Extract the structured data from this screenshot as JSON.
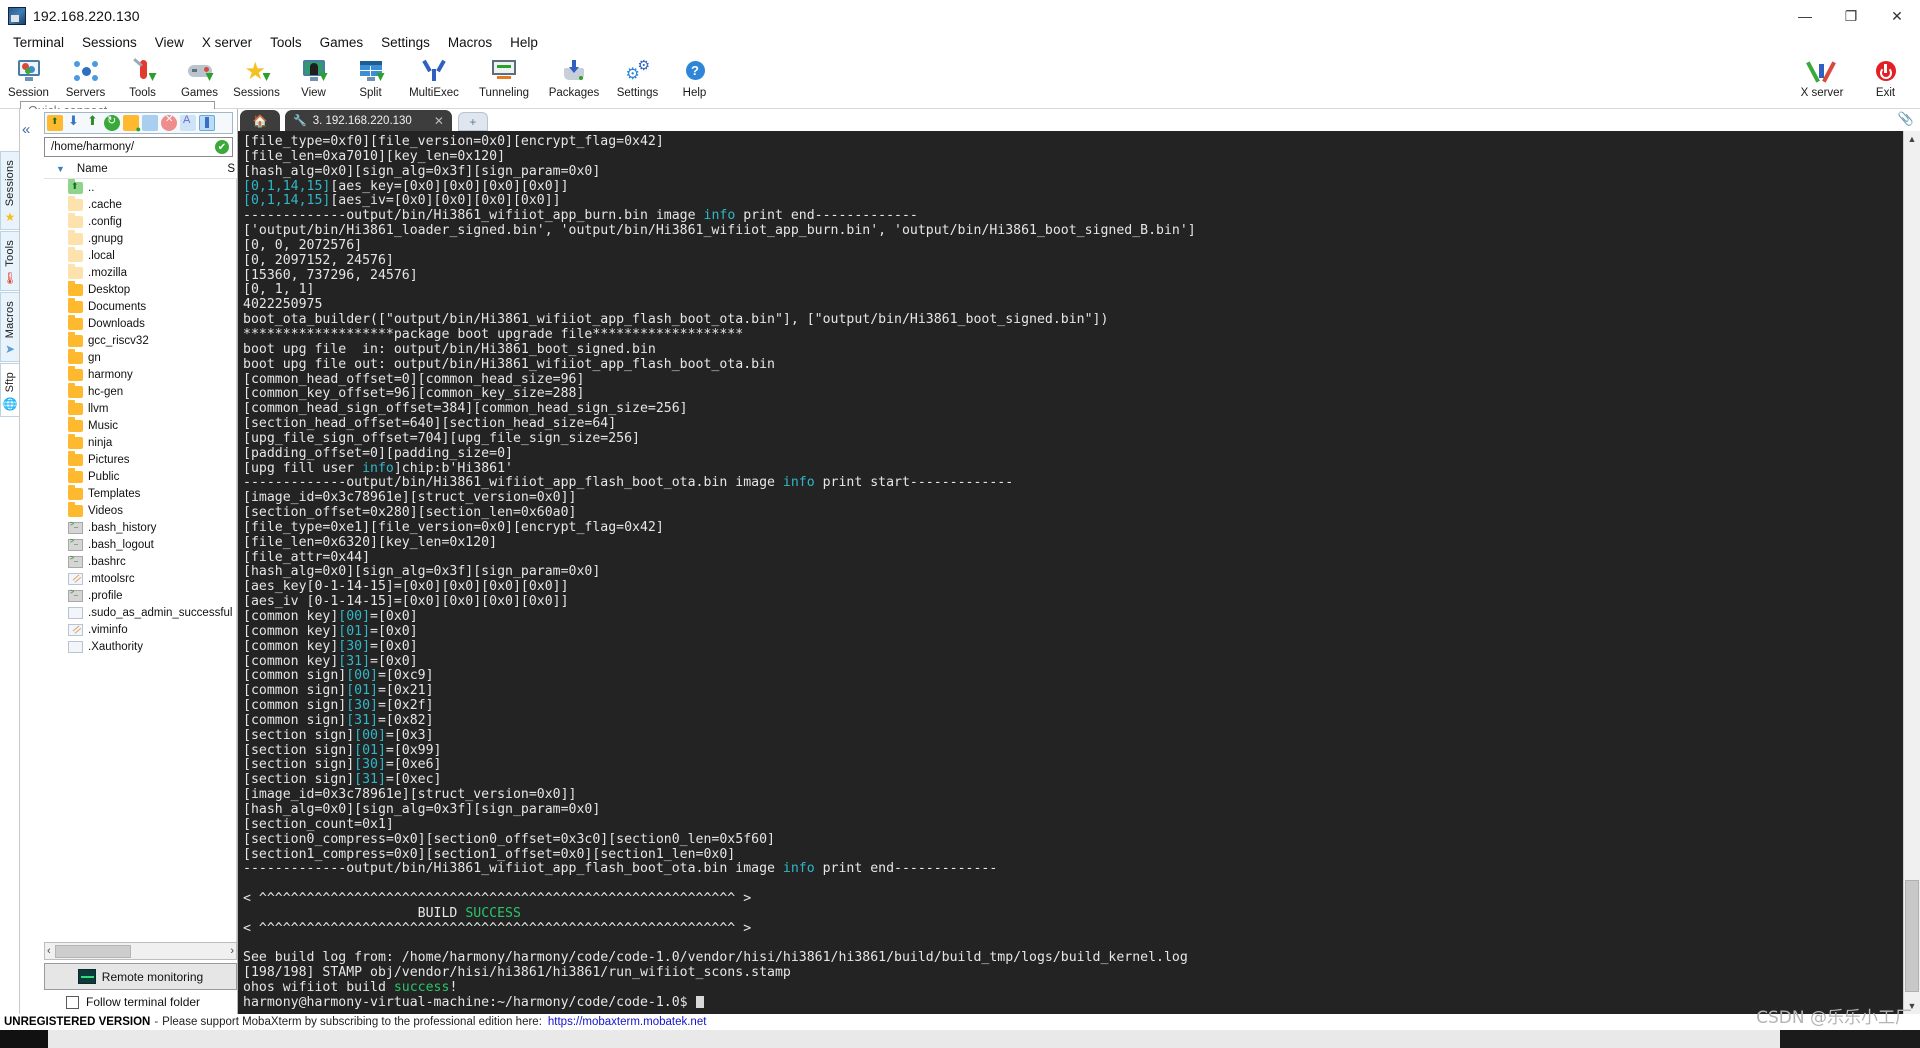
{
  "window": {
    "title": "192.168.220.130",
    "minimize": "—",
    "maximize": "❐",
    "close": "✕"
  },
  "menubar": [
    {
      "label": "Terminal"
    },
    {
      "label": "Sessions"
    },
    {
      "label": "View"
    },
    {
      "label": "X server"
    },
    {
      "label": "Tools"
    },
    {
      "label": "Games"
    },
    {
      "label": "Settings"
    },
    {
      "label": "Macros"
    },
    {
      "label": "Help"
    }
  ],
  "toolbar": {
    "items": [
      {
        "label": "Session",
        "icon": "session-icon"
      },
      {
        "label": "Servers",
        "icon": "servers-icon"
      },
      {
        "label": "Tools",
        "icon": "tools-icon"
      },
      {
        "label": "Games",
        "icon": "games-icon"
      },
      {
        "label": "Sessions",
        "icon": "sessions-star-icon"
      },
      {
        "label": "View",
        "icon": "view-icon"
      },
      {
        "label": "Split",
        "icon": "split-icon"
      },
      {
        "label": "MultiExec",
        "icon": "multiexec-icon"
      },
      {
        "label": "Tunneling",
        "icon": "tunneling-icon"
      },
      {
        "label": "Packages",
        "icon": "packages-icon"
      },
      {
        "label": "Settings",
        "icon": "settings-gear-icon"
      },
      {
        "label": "Help",
        "icon": "help-icon"
      }
    ],
    "right": [
      {
        "label": "X server",
        "icon": "x-server-icon"
      },
      {
        "label": "Exit",
        "icon": "power-exit-icon"
      }
    ]
  },
  "quick_connect": {
    "placeholder": "Quick connect...",
    "value": ""
  },
  "sidebar": {
    "vertical_tabs": [
      {
        "label": "Sessions",
        "icon": "star-icon"
      },
      {
        "label": "Tools",
        "icon": "thermometer-icon"
      },
      {
        "label": "Macros",
        "icon": "paper-plane-icon"
      },
      {
        "label": "Sftp",
        "icon": "globe-icon"
      }
    ],
    "sftp_toolbar_icons": [
      "parent-folder-icon",
      "download-icon",
      "upload-icon",
      "refresh-icon",
      "new-folder-icon",
      "new-file-icon",
      "delete-icon",
      "text-mode-icon",
      "bookmark-icon"
    ],
    "path": {
      "value": "/home/harmony/",
      "status": "✔"
    },
    "column_header": {
      "name": "Name",
      "size": "S"
    },
    "files": [
      {
        "name": "..",
        "type": "up"
      },
      {
        "name": ".cache",
        "type": "folder-pale"
      },
      {
        "name": ".config",
        "type": "folder-pale"
      },
      {
        "name": ".gnupg",
        "type": "folder-pale"
      },
      {
        "name": ".local",
        "type": "folder-pale"
      },
      {
        "name": ".mozilla",
        "type": "folder-pale"
      },
      {
        "name": "Desktop",
        "type": "folder"
      },
      {
        "name": "Documents",
        "type": "folder"
      },
      {
        "name": "Downloads",
        "type": "folder"
      },
      {
        "name": "gcc_riscv32",
        "type": "folder"
      },
      {
        "name": "gn",
        "type": "folder"
      },
      {
        "name": "harmony",
        "type": "folder"
      },
      {
        "name": "hc-gen",
        "type": "folder"
      },
      {
        "name": "llvm",
        "type": "folder"
      },
      {
        "name": "Music",
        "type": "folder"
      },
      {
        "name": "ninja",
        "type": "folder"
      },
      {
        "name": "Pictures",
        "type": "folder"
      },
      {
        "name": "Public",
        "type": "folder"
      },
      {
        "name": "Templates",
        "type": "folder"
      },
      {
        "name": "Videos",
        "type": "folder"
      },
      {
        "name": ".bash_history",
        "type": "shell"
      },
      {
        "name": ".bash_logout",
        "type": "shell"
      },
      {
        "name": ".bashrc",
        "type": "shell"
      },
      {
        "name": ".mtoolsrc",
        "type": "text"
      },
      {
        "name": ".profile",
        "type": "shell"
      },
      {
        "name": ".sudo_as_admin_successful",
        "type": "plain"
      },
      {
        "name": ".viminfo",
        "type": "text"
      },
      {
        "name": ".Xauthority",
        "type": "plain"
      }
    ],
    "remote_monitoring": "Remote monitoring",
    "follow_terminal_folder": "Follow terminal folder",
    "follow_checked": false
  },
  "tabs": {
    "home_icon": "home-icon",
    "session": {
      "label": "3. 192.168.220.130",
      "icon": "wrench-icon",
      "close": "✕"
    },
    "new_tab": "+"
  },
  "terminal": {
    "prompt": "harmony@harmony-virtual-machine:~/harmony/code/code-1.0$",
    "lines": [
      {
        "t": "[file_type=0xf0][file_version=0x0][encrypt_flag=0x42]"
      },
      {
        "t": "[file_len=0xa7010][key_len=0x120]"
      },
      {
        "t": "[hash_alg=0x0][sign_alg=0x3f][sign_param=0x0]"
      },
      {
        "t": "[aes_key",
        "p": [
          [
            "[0,1,14,15]",
            "cy"
          ],
          [
            "=[0x0][0x0][0x0][0x0]]",
            ""
          ]
        ]
      },
      {
        "t": "[aes_iv",
        "p": [
          [
            "[0,1,14,15]",
            "cy"
          ],
          [
            "=[0x0][0x0][0x0][0x0]]",
            ""
          ]
        ]
      },
      {
        "p": [
          [
            "-------------output/bin/Hi3861_wifiiot_app_burn.bin image ",
            ""
          ],
          [
            "info",
            "cy"
          ],
          [
            " print end-------------",
            ""
          ]
        ]
      },
      {
        "t": "['output/bin/Hi3861_loader_signed.bin', 'output/bin/Hi3861_wifiiot_app_burn.bin', 'output/bin/Hi3861_boot_signed_B.bin']"
      },
      {
        "t": "[0, 0, 2072576]"
      },
      {
        "t": "[0, 2097152, 24576]"
      },
      {
        "t": "[15360, 737296, 24576]"
      },
      {
        "t": "[0, 1, 1]"
      },
      {
        "t": "4022250975"
      },
      {
        "t": "boot_ota_builder([\"output/bin/Hi3861_wifiiot_app_flash_boot_ota.bin\"], [\"output/bin/Hi3861_boot_signed.bin\"])"
      },
      {
        "t": "*******************package boot upgrade file*******************"
      },
      {
        "t": "boot upg file  in: output/bin/Hi3861_boot_signed.bin"
      },
      {
        "t": "boot upg file out: output/bin/Hi3861_wifiiot_app_flash_boot_ota.bin"
      },
      {
        "t": "[common_head_offset=0][common_head_size=96]"
      },
      {
        "t": "[common_key_offset=96][common_key_size=288]"
      },
      {
        "t": "[common_head_sign_offset=384][common_head_sign_size=256]"
      },
      {
        "t": "[section_head_offset=640][section_head_size=64]"
      },
      {
        "t": "[upg_file_sign_offset=704][upg_file_sign_size=256]"
      },
      {
        "t": "[padding_offset=0][padding_size=0]"
      },
      {
        "p": [
          [
            "[upg fill user ",
            ""
          ],
          [
            "info",
            "cy"
          ],
          [
            "]chip:b'Hi3861'",
            ""
          ]
        ]
      },
      {
        "p": [
          [
            "-------------output/bin/Hi3861_wifiiot_app_flash_boot_ota.bin image ",
            ""
          ],
          [
            "info",
            "cy"
          ],
          [
            " print start-------------",
            ""
          ]
        ]
      },
      {
        "t": "[image_id=0x3c78961e][struct_version=0x0]]"
      },
      {
        "t": "[section_offset=0x280][section_len=0x60a0]"
      },
      {
        "t": "[file_type=0xe1][file_version=0x0][encrypt_flag=0x42]"
      },
      {
        "t": "[file_len=0x6320][key_len=0x120]"
      },
      {
        "t": "[file_attr=0x44]"
      },
      {
        "t": "[hash_alg=0x0][sign_alg=0x3f][sign_param=0x0]"
      },
      {
        "t": "[aes_key[0-1-14-15]=[0x0][0x0][0x0][0x0]]"
      },
      {
        "t": "[aes_iv [0-1-14-15]=[0x0][0x0][0x0][0x0]]"
      },
      {
        "p": [
          [
            "[common key]",
            ""
          ],
          [
            "[00]",
            "cy"
          ],
          [
            "=[0x0]",
            ""
          ]
        ]
      },
      {
        "p": [
          [
            "[common key]",
            ""
          ],
          [
            "[01]",
            "cy"
          ],
          [
            "=[0x0]",
            ""
          ]
        ]
      },
      {
        "p": [
          [
            "[common key]",
            ""
          ],
          [
            "[30]",
            "cy"
          ],
          [
            "=[0x0]",
            ""
          ]
        ]
      },
      {
        "p": [
          [
            "[common key]",
            ""
          ],
          [
            "[31]",
            "cy"
          ],
          [
            "=[0x0]",
            ""
          ]
        ]
      },
      {
        "p": [
          [
            "[common sign]",
            ""
          ],
          [
            "[00]",
            "cy"
          ],
          [
            "=[0xc9]",
            ""
          ]
        ]
      },
      {
        "p": [
          [
            "[common sign]",
            ""
          ],
          [
            "[01]",
            "cy"
          ],
          [
            "=[0x21]",
            ""
          ]
        ]
      },
      {
        "p": [
          [
            "[common sign]",
            ""
          ],
          [
            "[30]",
            "cy"
          ],
          [
            "=[0x2f]",
            ""
          ]
        ]
      },
      {
        "p": [
          [
            "[common sign]",
            ""
          ],
          [
            "[31]",
            "cy"
          ],
          [
            "=[0x82]",
            ""
          ]
        ]
      },
      {
        "p": [
          [
            "[section sign]",
            ""
          ],
          [
            "[00]",
            "cy"
          ],
          [
            "=[0x3]",
            ""
          ]
        ]
      },
      {
        "p": [
          [
            "[section sign]",
            ""
          ],
          [
            "[01]",
            "cy"
          ],
          [
            "=[0x99]",
            ""
          ]
        ]
      },
      {
        "p": [
          [
            "[section sign]",
            ""
          ],
          [
            "[30]",
            "cy"
          ],
          [
            "=[0xe6]",
            ""
          ]
        ]
      },
      {
        "p": [
          [
            "[section sign]",
            ""
          ],
          [
            "[31]",
            "cy"
          ],
          [
            "=[0xec]",
            ""
          ]
        ]
      },
      {
        "t": "[image_id=0x3c78961e][struct_version=0x0]]"
      },
      {
        "t": "[hash_alg=0x0][sign_alg=0x3f][sign_param=0x0]"
      },
      {
        "t": "[section_count=0x1]"
      },
      {
        "t": "[section0_compress=0x0][section0_offset=0x3c0][section0_len=0x5f60]"
      },
      {
        "t": "[section1_compress=0x0][section1_offset=0x0][section1_len=0x0]"
      },
      {
        "p": [
          [
            "-------------output/bin/Hi3861_wifiiot_app_flash_boot_ota.bin image ",
            ""
          ],
          [
            "info",
            "cy"
          ],
          [
            " print end-------------",
            ""
          ]
        ]
      },
      {
        "t": ""
      },
      {
        "t": "< ^^^^^^^^^^^^^^^^^^^^^^^^^^^^^^^^^^^^^^^^^^^^^^^^^^^^^^^^^^^^ >"
      },
      {
        "p": [
          [
            "                      BUILD ",
            ""
          ],
          [
            "SUCCESS",
            "gr"
          ]
        ]
      },
      {
        "t": "< ^^^^^^^^^^^^^^^^^^^^^^^^^^^^^^^^^^^^^^^^^^^^^^^^^^^^^^^^^^^^ >"
      },
      {
        "t": ""
      },
      {
        "t": "See build log from: /home/harmony/harmony/code/code-1.0/vendor/hisi/hi3861/hi3861/build/build_tmp/logs/build_kernel.log"
      },
      {
        "t": "[198/198] STAMP obj/vendor/hisi/hi3861/hi3861/run_wifiiot_scons.stamp"
      },
      {
        "p": [
          [
            "ohos wifiiot build ",
            ""
          ],
          [
            "success",
            "gr"
          ],
          [
            "!",
            ""
          ]
        ]
      }
    ]
  },
  "footer": {
    "badge": "UNREGISTERED VERSION",
    "dash": "-",
    "message": "Please support MobaXterm by subscribing to the professional edition here:",
    "link": "https://mobaxterm.mobatek.net"
  },
  "watermark": "CSDN @乐乐小工厂",
  "colors": {
    "accent": "#3b7fd4",
    "success": "#29c46a",
    "cyan": "#2fb8c8",
    "terminal_bg": "#232323",
    "tab_bg": "#3d3d3d",
    "link": "#1414d0"
  }
}
